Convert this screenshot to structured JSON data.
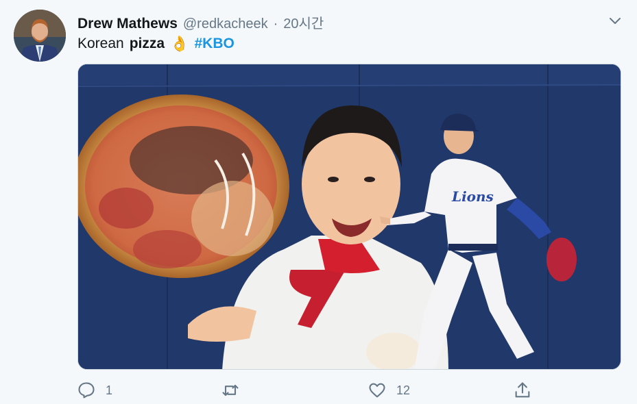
{
  "tweet": {
    "author": {
      "display_name": "Drew Mathews",
      "handle": "@redkacheek",
      "separator": "·",
      "timestamp": "20시간"
    },
    "text": {
      "word1": "Korean",
      "word2": "pizza",
      "emoji": "👌",
      "hashtag": "#KBO"
    },
    "media": {
      "description_icon": "photo"
    },
    "actions": {
      "reply_count": "1",
      "retweet_count": "",
      "like_count": "12"
    },
    "colors": {
      "accent": "#1b95e0",
      "muted": "#657786",
      "background": "#f5f8fa"
    }
  }
}
